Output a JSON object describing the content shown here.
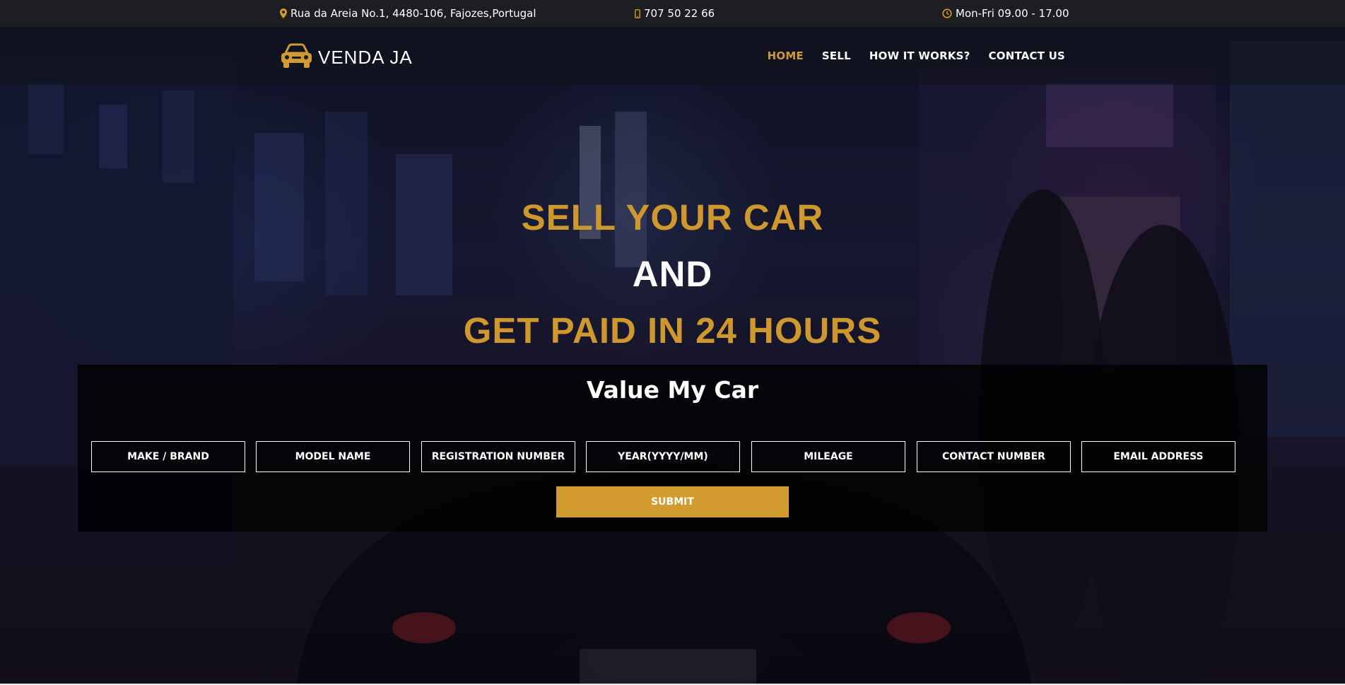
{
  "topbar": {
    "address": "Rua da Areia No.1, 4480-106, Fajozes,Portugal",
    "address_icon": "map-marker-icon",
    "phone": "707 50 22 66",
    "phone_icon": "mobile-phone-icon",
    "hours": "Mon-Fri 09.00 - 17.00",
    "hours_icon": "clock-icon"
  },
  "brand": {
    "name": "VENDA JA",
    "logo_icon": "car-icon"
  },
  "nav": {
    "items": [
      {
        "label": "HOME",
        "active": true
      },
      {
        "label": "SELL",
        "active": false
      },
      {
        "label": "HOW IT WORKS?",
        "active": false
      },
      {
        "label": "CONTACT US",
        "active": false
      }
    ]
  },
  "hero": {
    "line1": "SELL YOUR CAR",
    "line2": "AND",
    "line3": "GET PAID IN 24 HOURS"
  },
  "form": {
    "title": "Value My Car",
    "fields": [
      {
        "placeholder": "MAKE / BRAND",
        "value": ""
      },
      {
        "placeholder": "MODEL NAME",
        "value": ""
      },
      {
        "placeholder": "REGISTRATION NUMBER",
        "value": ""
      },
      {
        "placeholder": "YEAR(YYYY/MM)",
        "value": ""
      },
      {
        "placeholder": "MILEAGE",
        "value": ""
      },
      {
        "placeholder": "CONTACT NUMBER",
        "value": ""
      },
      {
        "placeholder": "EMAIL ADDRESS",
        "value": ""
      }
    ],
    "submit_label": "SUBMIT"
  },
  "colors": {
    "accent": "#d19b2f",
    "topbar_bg": "#1d1e22",
    "text": "#ffffff"
  }
}
